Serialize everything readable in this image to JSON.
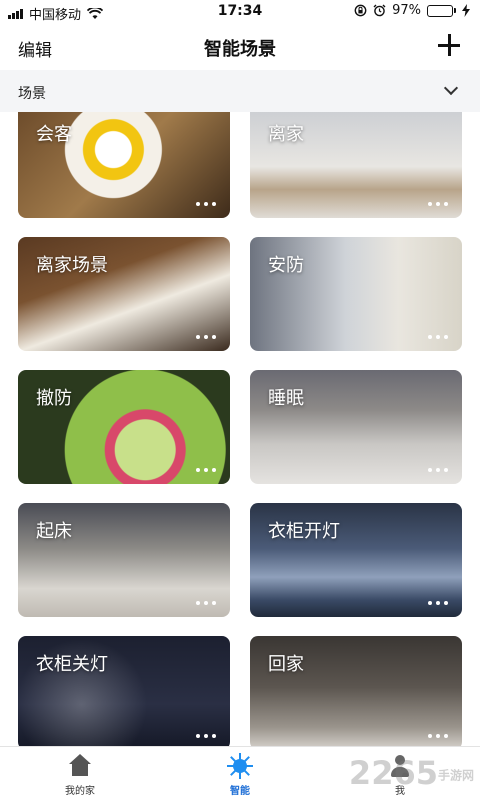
{
  "status_bar": {
    "carrier": "中国移动",
    "time": "17:34",
    "battery": "97%",
    "battery_level": 0.97
  },
  "header": {
    "edit_label": "编辑",
    "title": "智能场景"
  },
  "section": {
    "label": "场景"
  },
  "scenes": [
    {
      "name": "会客"
    },
    {
      "name": "离家"
    },
    {
      "name": "离家场景"
    },
    {
      "name": "安防"
    },
    {
      "name": "撤防"
    },
    {
      "name": "睡眠"
    },
    {
      "name": "起床"
    },
    {
      "name": "衣柜开灯"
    },
    {
      "name": "衣柜关灯"
    },
    {
      "name": "回家"
    }
  ],
  "nav": {
    "home": "我的家",
    "smart": "智能",
    "me": "我"
  },
  "watermark": {
    "main": "2265",
    "sub": "手游网"
  },
  "colors": {
    "accent": "#1f6fd6"
  }
}
